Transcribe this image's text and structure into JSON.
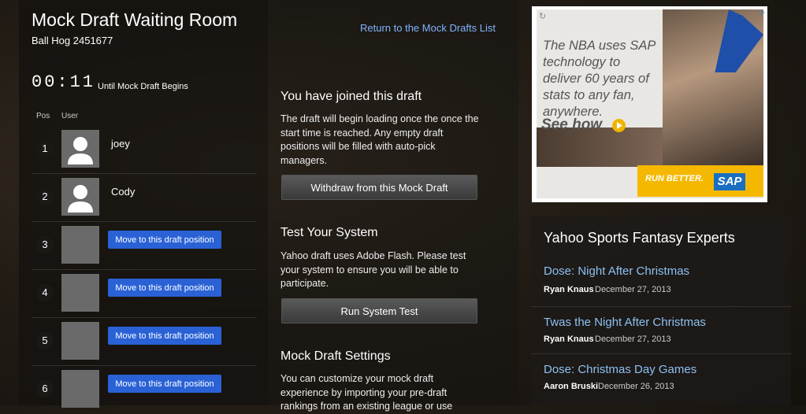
{
  "header": {
    "title": "Mock Draft Waiting Room",
    "subtitle": "Ball Hog 2451677",
    "return_link": "Return to the Mock Drafts List"
  },
  "timer": {
    "value": "00:11",
    "label": "Until Mock Draft Begins"
  },
  "table": {
    "columns": [
      "Pos",
      "User"
    ],
    "rows": [
      {
        "pos": "1",
        "user": "joey",
        "has_avatar": true
      },
      {
        "pos": "2",
        "user": "Cody",
        "has_avatar": true
      },
      {
        "pos": "3",
        "button": "Move to this draft position"
      },
      {
        "pos": "4",
        "button": "Move to this draft position"
      },
      {
        "pos": "5",
        "button": "Move to this draft position"
      },
      {
        "pos": "6",
        "button": "Move to this draft position"
      }
    ]
  },
  "joined": {
    "heading": "You have joined this draft",
    "text": "The draft will begin loading once the once the start time is reached. Any empty draft positions will be filled with auto-pick managers.",
    "button": "Withdraw from this Mock Draft"
  },
  "test": {
    "heading": "Test Your System",
    "text": "Yahoo draft uses Adobe Flash. Please test your system to ensure you will be able to participate.",
    "button": "Run System Test"
  },
  "settings": {
    "heading": "Mock Draft Settings",
    "text": "You can customize your mock draft experience by importing your pre-draft rankings from an existing league or use"
  },
  "ad": {
    "text": "The NBA uses SAP technology to deliver 60 years of stats to any fan, anywhere.",
    "see_how": "See how",
    "run_better": "RUN BETTER.",
    "brand": "SAP"
  },
  "experts": {
    "title": "Yahoo Sports Fantasy Experts",
    "items": [
      {
        "headline": "Dose: Night After Christmas",
        "author": "Ryan Knaus",
        "date": "December 27, 2013"
      },
      {
        "headline": "Twas the Night After Christmas",
        "author": "Ryan Knaus",
        "date": "December 27, 2013"
      },
      {
        "headline": "Dose: Christmas Day Games",
        "author": "Aaron Bruski",
        "date": "December 26, 2013"
      }
    ]
  },
  "colors": {
    "link": "#7fb4ff",
    "button_blue": "#2a62d6",
    "ad_accent": "#f5b800"
  }
}
